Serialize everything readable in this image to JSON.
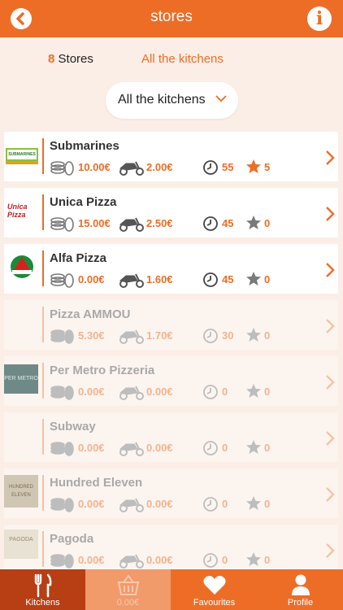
{
  "header": {
    "title": "stores",
    "back_icon": "back-arrow-icon",
    "info_icon": "info-icon",
    "info_glyph": "i"
  },
  "summary": {
    "count": "8",
    "count_label": "Stores",
    "kitchens_link": "All the kitchens"
  },
  "filter": {
    "selected": "All the kitchens"
  },
  "stores": [
    {
      "name": "Submarines",
      "min_order": "10.00€",
      "delivery_fee": "2.00€",
      "delivery_time": "55",
      "rating": "5",
      "available": true,
      "rated": true,
      "logo_text": "SUBMARINES"
    },
    {
      "name": "Unica Pizza",
      "min_order": "15.00€",
      "delivery_fee": "2.50€",
      "delivery_time": "45",
      "rating": "0",
      "available": true,
      "rated": false,
      "logo_text": "Unica Pizza"
    },
    {
      "name": "Alfa Pizza",
      "min_order": "0.00€",
      "delivery_fee": "1.60€",
      "delivery_time": "45",
      "rating": "0",
      "available": true,
      "rated": false,
      "logo_text": ""
    },
    {
      "name": "Pizza AMMOU",
      "min_order": "5.30€",
      "delivery_fee": "1.70€",
      "delivery_time": "30",
      "rating": "0",
      "available": false,
      "rated": false,
      "logo_text": ""
    },
    {
      "name": "Per Metro Pizzeria",
      "min_order": "0.00€",
      "delivery_fee": "0.00€",
      "delivery_time": "0",
      "rating": "0",
      "available": false,
      "rated": false,
      "logo_text": "PER METRO"
    },
    {
      "name": "Subway",
      "min_order": "0.00€",
      "delivery_fee": "0.00€",
      "delivery_time": "0",
      "rating": "0",
      "available": false,
      "rated": false,
      "logo_text": ""
    },
    {
      "name": "Hundred Eleven",
      "min_order": "0.00€",
      "delivery_fee": "0.00€",
      "delivery_time": "0",
      "rating": "0",
      "available": false,
      "rated": false,
      "logo_text": "HUNDRED ELEVEN"
    },
    {
      "name": "Pagoda",
      "min_order": "0.00€",
      "delivery_fee": "0.00€",
      "delivery_time": "0",
      "rating": "0",
      "available": false,
      "rated": false,
      "logo_text": "PAGODA"
    }
  ],
  "tabbar": [
    {
      "label": "Kitchens",
      "icon": "fork-knife-icon",
      "active": true
    },
    {
      "label": "0.00€",
      "icon": "basket-icon",
      "active": false
    },
    {
      "label": "Favourites",
      "icon": "heart-icon",
      "active": false
    },
    {
      "label": "Profile",
      "icon": "person-icon",
      "active": false
    }
  ],
  "colors": {
    "accent": "#ee6d26",
    "accent_dark": "#b83e13",
    "background": "#fbeee6",
    "disabled_text": "#a9a9a9"
  }
}
